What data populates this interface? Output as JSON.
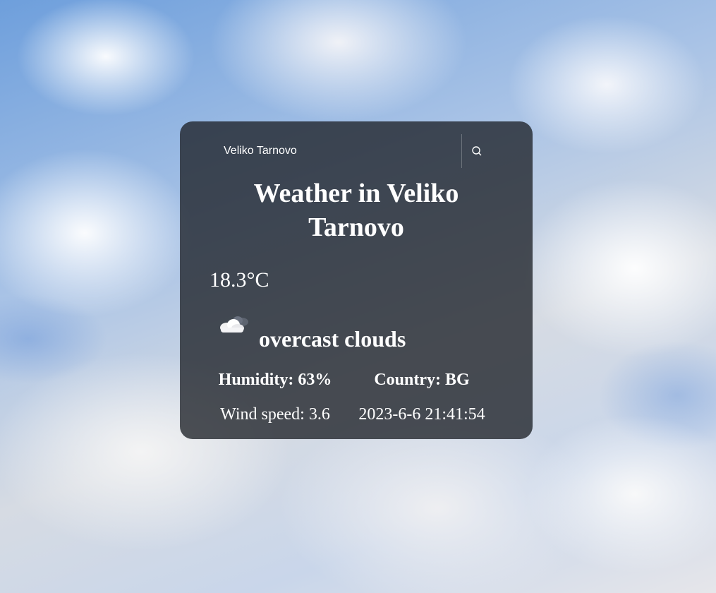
{
  "search": {
    "value": "Veliko Tarnovo",
    "icon": "search-icon"
  },
  "weather": {
    "title": "Weather in Veliko Tarnovo",
    "temperature": "18.3°C",
    "icon": "cloud-icon",
    "description": "overcast clouds",
    "humidity": "Humidity: 63%",
    "country": "Country: BG",
    "wind": "Wind speed: 3.6",
    "datetime": "2023-6-6 21:41:54"
  }
}
